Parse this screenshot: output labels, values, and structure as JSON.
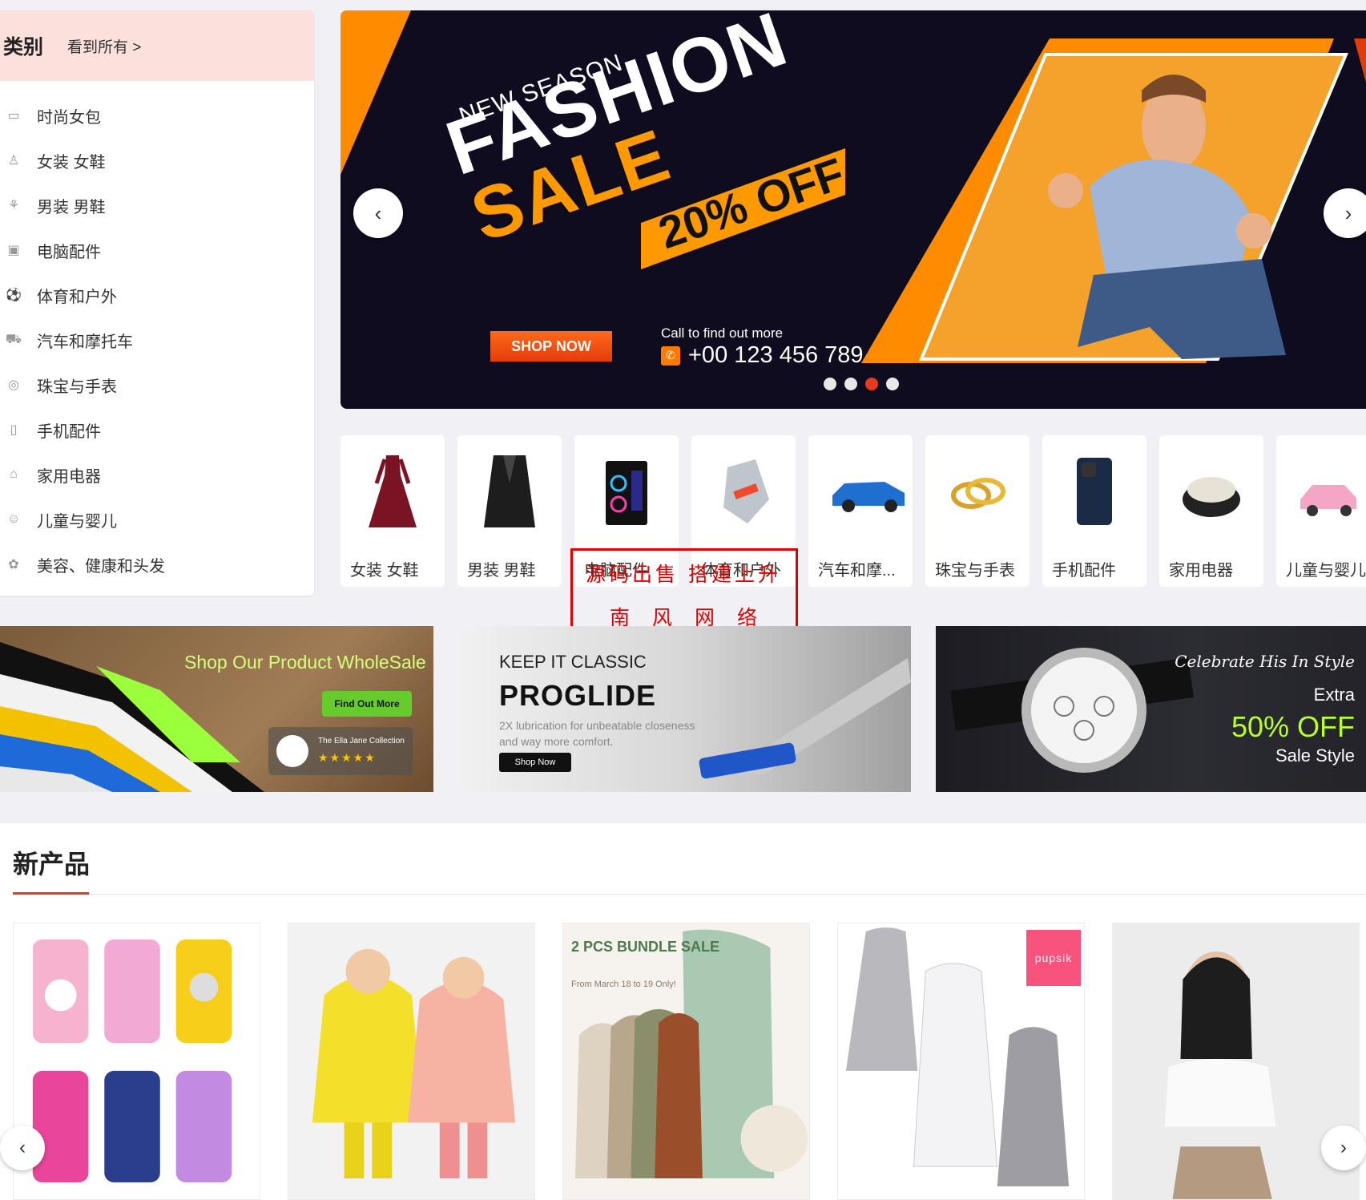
{
  "sidebar": {
    "title": "类别",
    "view_all": "看到所有 >",
    "items": [
      {
        "label": "时尚女包",
        "icon": "bag-icon"
      },
      {
        "label": "女装 女鞋",
        "icon": "dress-icon"
      },
      {
        "label": "男装 男鞋",
        "icon": "shirt-icon"
      },
      {
        "label": "电脑配件",
        "icon": "computer-icon"
      },
      {
        "label": "体育和户外",
        "icon": "sports-icon"
      },
      {
        "label": "汽车和摩托车",
        "icon": "car-icon"
      },
      {
        "label": "珠宝与手表",
        "icon": "watch-icon"
      },
      {
        "label": "手机配件",
        "icon": "phone-icon"
      },
      {
        "label": "家用电器",
        "icon": "appliance-icon"
      },
      {
        "label": "儿童与婴儿",
        "icon": "baby-icon"
      },
      {
        "label": "美容、健康和头发",
        "icon": "beauty-icon"
      }
    ]
  },
  "banner": {
    "season": "NEW SEASON",
    "headline": "FASHION",
    "sale": "SALE",
    "discount": "20% OFF",
    "cta": "SHOP NOW",
    "call_label": "Call to find out more",
    "phone": "+00 123 456 789",
    "slides": 4,
    "active_slide": 3,
    "colors": {
      "accent": "#ff9900",
      "cta": "#e53a1f",
      "bg": "#0e0c1e"
    }
  },
  "categories": [
    {
      "label": "女装 女鞋",
      "icon": "dress-icon"
    },
    {
      "label": "男装 男鞋",
      "icon": "suit-icon"
    },
    {
      "label": "电脑配件",
      "icon": "pc-case-icon"
    },
    {
      "label": "体育和户外",
      "icon": "glove-icon"
    },
    {
      "label": "汽车和摩...",
      "icon": "car-icon"
    },
    {
      "label": "珠宝与手表",
      "icon": "ring-icon"
    },
    {
      "label": "手机配件",
      "icon": "phone-icon"
    },
    {
      "label": "家用电器",
      "icon": "chair-icon"
    },
    {
      "label": "儿童与婴儿",
      "icon": "toy-car-icon"
    }
  ],
  "watermark": {
    "line1": "源码出售 搭建上升",
    "line2": "南风网络"
  },
  "promos": {
    "wholesale": {
      "title": "Shop Our Product WholeSale",
      "cta": "Find Out More",
      "brand": "The Ella Jane Collection",
      "stars": "★★★★★"
    },
    "proglide": {
      "kicker": "KEEP IT CLASSIC",
      "title": "PROGLIDE",
      "subtitle": "2X lubrication for unbeatable closeness and way more comfort.",
      "cta": "Shop Now"
    },
    "watch": {
      "tagline": "Celebrate His In Style",
      "extra": "Extra",
      "discount": "50% OFF",
      "style": "Sale Style"
    }
  },
  "new_products": {
    "title": "新产品",
    "items": [
      {
        "name": "kids-luggage"
      },
      {
        "name": "kids-raincoat"
      },
      {
        "name": "baby-sleep-sack-bundle",
        "headline": "2 PCS BUNDLE SALE",
        "note": "From March 18 to 19 Only!"
      },
      {
        "name": "baby-sleep-sack-pupsik",
        "brand": "pupsik"
      },
      {
        "name": "women-crop-top"
      }
    ]
  }
}
